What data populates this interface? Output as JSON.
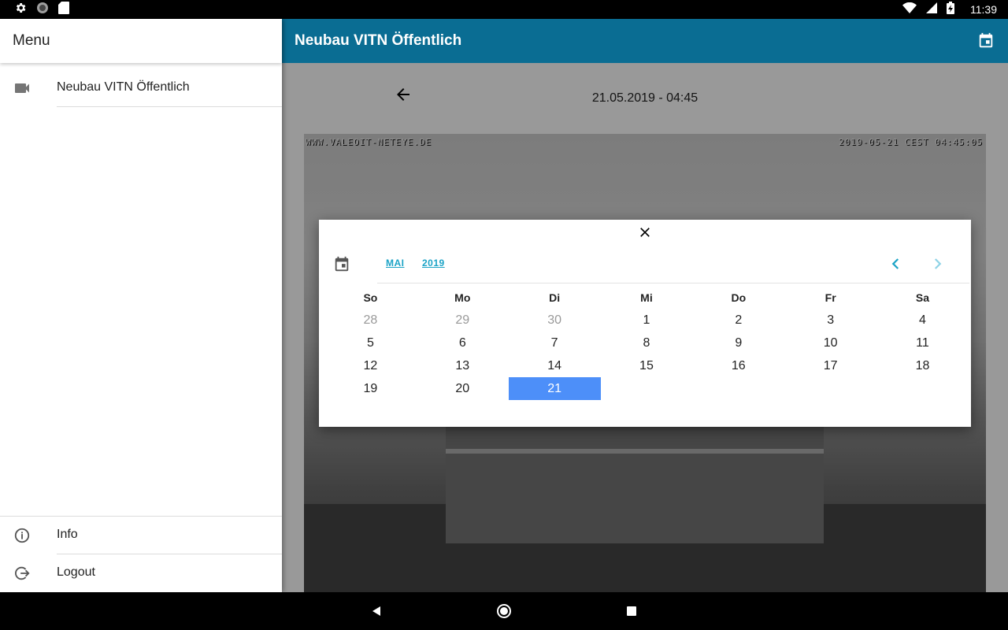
{
  "statusbar": {
    "time": "11:39"
  },
  "appbar": {
    "title": "Neubau VITN Öffentlich"
  },
  "content": {
    "date_label": "21.05.2019 - 04:45"
  },
  "camera": {
    "watermark_left": "WWW.VALEOIT-NETEYE.DE",
    "watermark_right": "2019-05-21 CEST 04:45:05"
  },
  "drawer": {
    "title": "Menu",
    "camera_item": "Neubau VITN Öffentlich",
    "info_item": "Info",
    "logout_item": "Logout"
  },
  "datepicker": {
    "month": "MAI",
    "year": "2019",
    "weekdays": [
      "So",
      "Mo",
      "Di",
      "Mi",
      "Do",
      "Fr",
      "Sa"
    ],
    "days": [
      {
        "label": "28",
        "muted": true
      },
      {
        "label": "29",
        "muted": true
      },
      {
        "label": "30",
        "muted": true
      },
      {
        "label": "1"
      },
      {
        "label": "2"
      },
      {
        "label": "3"
      },
      {
        "label": "4"
      },
      {
        "label": "5"
      },
      {
        "label": "6"
      },
      {
        "label": "7"
      },
      {
        "label": "8"
      },
      {
        "label": "9"
      },
      {
        "label": "10"
      },
      {
        "label": "11"
      },
      {
        "label": "12"
      },
      {
        "label": "13"
      },
      {
        "label": "14"
      },
      {
        "label": "15"
      },
      {
        "label": "16"
      },
      {
        "label": "17"
      },
      {
        "label": "18"
      },
      {
        "label": "19"
      },
      {
        "label": "20"
      },
      {
        "label": "21",
        "selected": true
      }
    ]
  },
  "colors": {
    "appbar": "#0a6d93",
    "accent": "#1ba3c6",
    "selected": "#4d8ff9"
  }
}
